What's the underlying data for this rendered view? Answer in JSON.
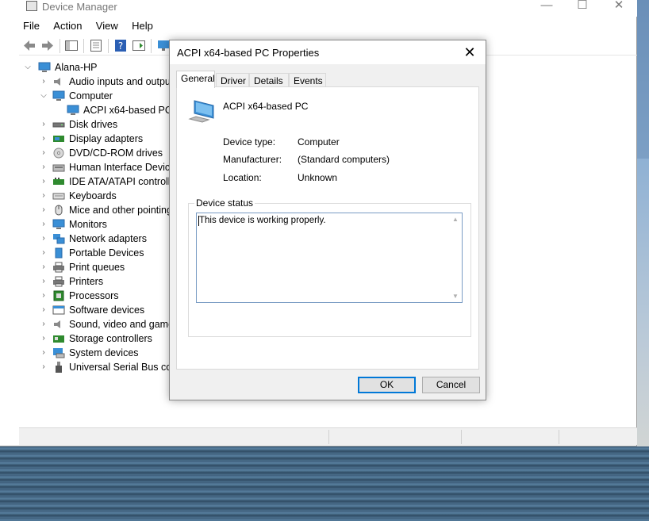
{
  "window": {
    "title": "Device Manager",
    "controls": {
      "minimize": "—",
      "maximize": "☐",
      "close": "✕"
    }
  },
  "menu": [
    "File",
    "Action",
    "View",
    "Help"
  ],
  "tree": {
    "root": "Alana-HP",
    "items": [
      {
        "label": "Audio inputs and outputs",
        "icon": "speaker-icon",
        "expanded": false
      },
      {
        "label": "Computer",
        "icon": "monitor-icon",
        "expanded": true
      },
      {
        "label": "ACPI x64-based PC",
        "icon": "monitor-icon",
        "child": true
      },
      {
        "label": "Disk drives",
        "icon": "disk-icon",
        "expanded": false
      },
      {
        "label": "Display adapters",
        "icon": "display-adapter-icon",
        "expanded": false
      },
      {
        "label": "DVD/CD-ROM drives",
        "icon": "dvd-icon",
        "expanded": false
      },
      {
        "label": "Human Interface Devices",
        "icon": "hid-icon",
        "expanded": false
      },
      {
        "label": "IDE ATA/ATAPI controllers",
        "icon": "ide-icon",
        "expanded": false
      },
      {
        "label": "Keyboards",
        "icon": "keyboard-icon",
        "expanded": false
      },
      {
        "label": "Mice and other pointing devices",
        "icon": "mouse-icon",
        "expanded": false
      },
      {
        "label": "Monitors",
        "icon": "monitor-icon",
        "expanded": false
      },
      {
        "label": "Network adapters",
        "icon": "network-icon",
        "expanded": false
      },
      {
        "label": "Portable Devices",
        "icon": "portable-device-icon",
        "expanded": false
      },
      {
        "label": "Print queues",
        "icon": "printer-icon",
        "expanded": false
      },
      {
        "label": "Printers",
        "icon": "printer-icon",
        "expanded": false
      },
      {
        "label": "Processors",
        "icon": "processor-icon",
        "expanded": false
      },
      {
        "label": "Software devices",
        "icon": "software-device-icon",
        "expanded": false
      },
      {
        "label": "Sound, video and game controllers",
        "icon": "speaker-icon",
        "expanded": false
      },
      {
        "label": "Storage controllers",
        "icon": "storage-icon",
        "expanded": false
      },
      {
        "label": "System devices",
        "icon": "system-icon",
        "expanded": false
      },
      {
        "label": "Universal Serial Bus controllers",
        "icon": "usb-icon",
        "expanded": false
      }
    ]
  },
  "dialog": {
    "title": "ACPI x64-based PC Properties",
    "close": "✕",
    "tabs": [
      "General",
      "Driver",
      "Details",
      "Events"
    ],
    "active_tab": "General",
    "device_name": "ACPI x64-based PC",
    "properties": [
      {
        "label": "Device type:",
        "value": "Computer"
      },
      {
        "label": "Manufacturer:",
        "value": "(Standard computers)"
      },
      {
        "label": "Location:",
        "value": "Unknown"
      }
    ],
    "status_group_title": "Device status",
    "status_text": "This device is working properly.",
    "ok_label": "OK",
    "cancel_label": "Cancel"
  },
  "colors": {
    "accent": "#0078d7",
    "monitor_blue": "#3a8fd6"
  }
}
